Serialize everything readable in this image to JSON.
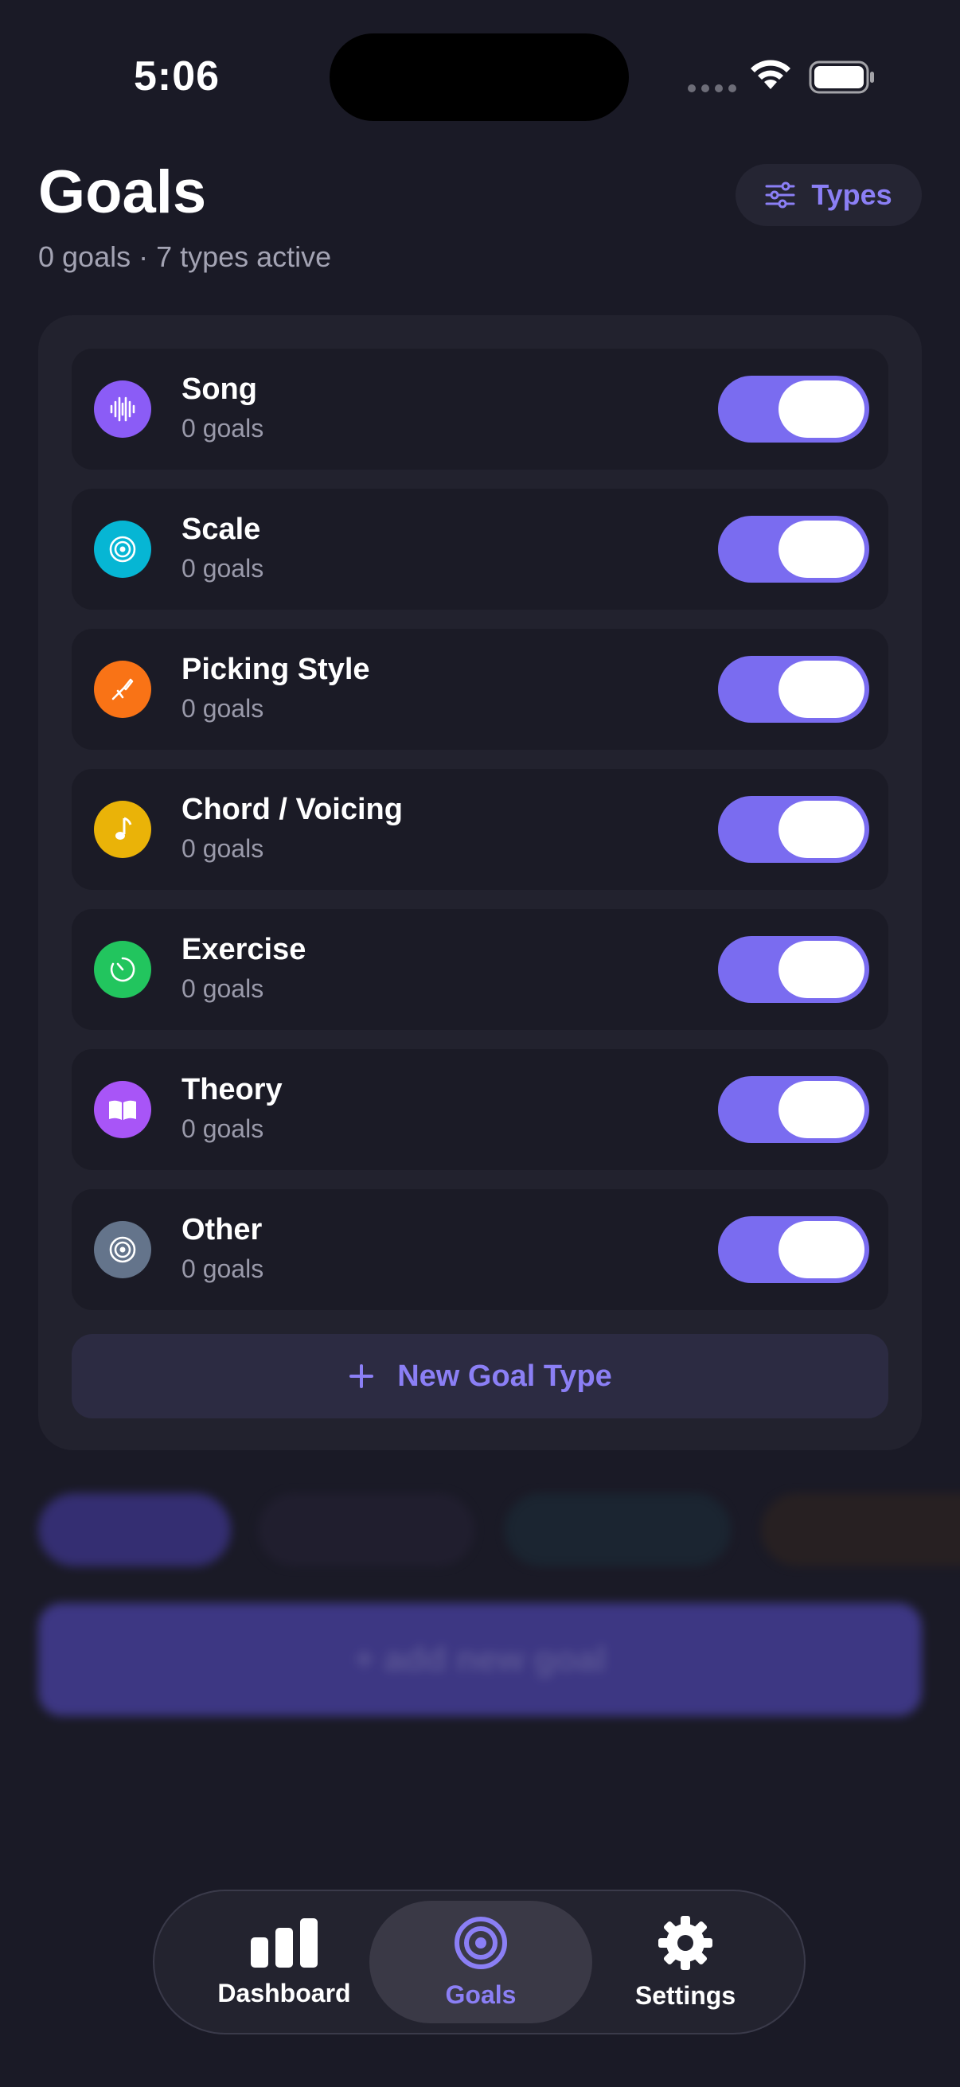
{
  "status": {
    "time": "5:06"
  },
  "header": {
    "title": "Goals",
    "subtitle": "0 goals · 7 types active",
    "types_button": "Types"
  },
  "goal_types": [
    {
      "name": "Song",
      "count": "0 goals",
      "color": "#8b5cf6",
      "icon": "waveform-icon",
      "enabled": true
    },
    {
      "name": "Scale",
      "count": "0 goals",
      "color": "#06b6d4",
      "icon": "target-icon",
      "enabled": true
    },
    {
      "name": "Picking Style",
      "count": "0 goals",
      "color": "#f97316",
      "icon": "guitar-pick-icon",
      "enabled": true
    },
    {
      "name": "Chord / Voicing",
      "count": "0 goals",
      "color": "#eab308",
      "icon": "music-note-icon",
      "enabled": true
    },
    {
      "name": "Exercise",
      "count": "0 goals",
      "color": "#22c55e",
      "icon": "timer-icon",
      "enabled": true
    },
    {
      "name": "Theory",
      "count": "0 goals",
      "color": "#a855f7",
      "icon": "book-icon",
      "enabled": true
    },
    {
      "name": "Other",
      "count": "0 goals",
      "color": "#64748b",
      "icon": "target-icon",
      "enabled": true
    }
  ],
  "new_goal_type_label": "New Goal Type",
  "background": {
    "add_goal_label": "+ add new goal"
  },
  "tabbar": {
    "tabs": [
      {
        "label": "Dashboard",
        "icon": "bar-chart-icon",
        "active": false
      },
      {
        "label": "Goals",
        "icon": "target-icon",
        "active": true
      },
      {
        "label": "Settings",
        "icon": "gear-icon",
        "active": false
      }
    ]
  },
  "colors": {
    "accent": "#7a6cf0",
    "background": "#1a1a26"
  }
}
